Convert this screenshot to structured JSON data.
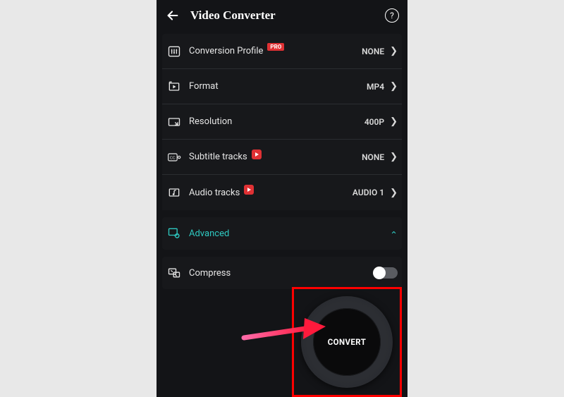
{
  "header": {
    "title": "Video Converter"
  },
  "settings": {
    "items": [
      {
        "icon": "sliders-icon",
        "label": "Conversion Profile",
        "badge": "PRO",
        "value": "NONE"
      },
      {
        "icon": "format-icon",
        "label": "Format",
        "value": "MP4"
      },
      {
        "icon": "resolution-icon",
        "label": "Resolution",
        "value": "400P"
      },
      {
        "icon": "cc-icon",
        "label": "Subtitle tracks",
        "redBadge": true,
        "value": "NONE"
      },
      {
        "icon": "audio-icon",
        "label": "Audio tracks",
        "redBadge": true,
        "value": "AUDIO 1"
      }
    ]
  },
  "advanced": {
    "label": "Advanced"
  },
  "compress": {
    "label": "Compress",
    "on": false
  },
  "action": {
    "convert_label": "CONVERT"
  },
  "badges": {
    "pro": "PRO"
  }
}
